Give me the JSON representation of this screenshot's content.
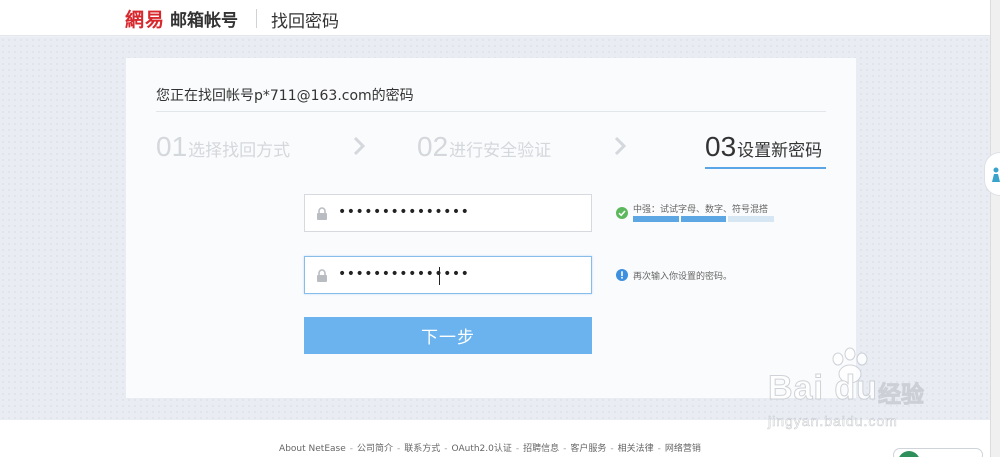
{
  "header": {
    "logo_brand": "網易",
    "logo_product": "邮箱帐号",
    "page_title": "找回密码"
  },
  "card": {
    "title": "您正在找回帐号p*711@163.com的密码",
    "steps": [
      {
        "num": "01",
        "label": "选择找回方式",
        "active": false
      },
      {
        "num": "02",
        "label": "进行安全验证",
        "active": false
      },
      {
        "num": "03",
        "label": "设置新密码",
        "active": true
      }
    ]
  },
  "form": {
    "password_value": "•••••••••••••••",
    "confirm_value": "•••••••••••••••",
    "strength_hint": "中强：试试字母、数字、符号混搭",
    "strength_level": 2,
    "strength_segments": 3,
    "confirm_hint": "再次输入你设置的密码。",
    "next_button": "下一步"
  },
  "footer": {
    "links": [
      "About NetEase",
      "公司简介",
      "联系方式",
      "OAuth2.0认证",
      "招聘信息",
      "客户服务",
      "相关法律",
      "网络营销"
    ]
  },
  "watermark": {
    "brand": "Bai du",
    "cn": "经验",
    "url": "jingyan.baidu.com"
  },
  "colors": {
    "brand_red": "#d7282e",
    "accent_blue": "#5aa5e6",
    "button_blue": "#6ab3ee",
    "success_green": "#5cb85c",
    "info_blue": "#3d8fe0"
  }
}
